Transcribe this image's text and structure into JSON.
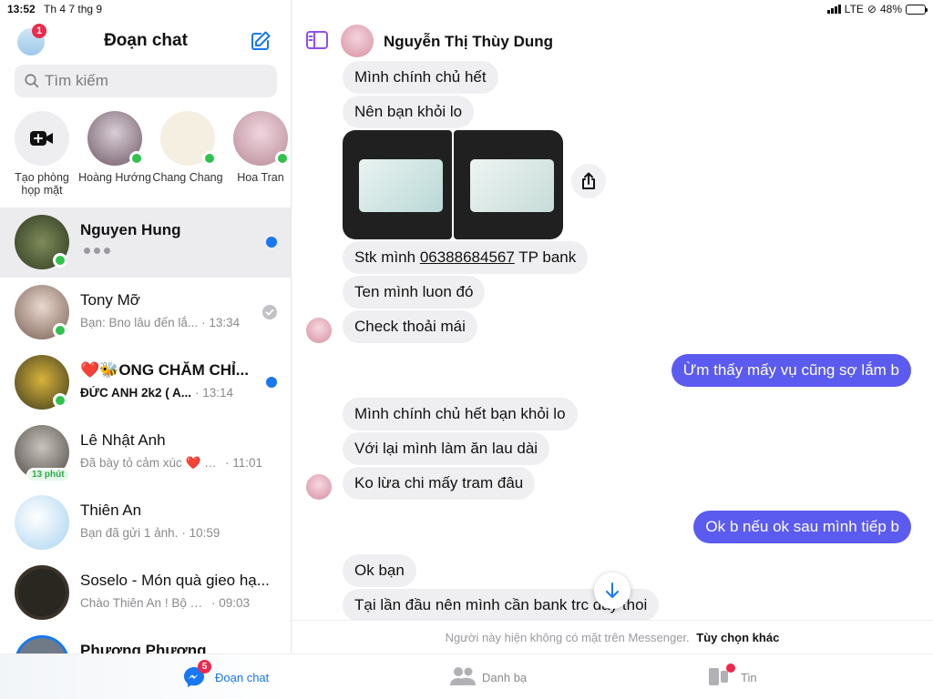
{
  "status_bar": {
    "time": "13:52",
    "date": "Th 4 7 thg 9",
    "network": "LTE",
    "battery": "48%",
    "battery_level": 0.48
  },
  "sidebar": {
    "title": "Đoạn chat",
    "profile_badge": "1",
    "search_placeholder": "Tìm kiếm",
    "stories": [
      {
        "label": "Tạo phòng họp mặt",
        "icon": "video-plus-icon"
      },
      {
        "label": "Hoàng Hướng",
        "online": true
      },
      {
        "label": "Chang Chang",
        "online": true
      },
      {
        "label": "Hoa Tran",
        "online": true
      }
    ],
    "chats": [
      {
        "name": "Nguyen Hung",
        "typing": true,
        "unread": true,
        "online": true
      },
      {
        "name": "Tony Mỡ",
        "preview": "Bạn: Bno lâu đến lắ...",
        "time": "· 13:34",
        "seen": true,
        "online": true
      },
      {
        "name": "❤️🐝ONG CHĂM CHỈ...",
        "preview": "ĐỨC ANH  2k2 ( A...",
        "time": "· 13:14",
        "unread": true,
        "online": true
      },
      {
        "name": "Lê Nhật Anh",
        "preview": "Đã bày tỏ cảm xúc ❤️ về...",
        "time": "· 11:01",
        "badge": "13 phút"
      },
      {
        "name": "Thiên An",
        "preview": "Bạn đã gửi 1 ảnh.",
        "time": "· 10:59"
      },
      {
        "name": "Soselo - Món quà gieo hạ...",
        "preview": "Chào Thiên An ! Bộ sưu...",
        "time": "· 09:03"
      },
      {
        "name": "Phương Phương",
        "preview": "",
        "time": ""
      }
    ]
  },
  "conversation": {
    "contact_name": "Nguyễn Thị Thùy Dung",
    "messages": [
      {
        "text": "Mình chính chủ hết",
        "dir": "in"
      },
      {
        "text": "Nên bạn khỏi lo",
        "dir": "in"
      },
      {
        "text_before": "Stk mình ",
        "account": "06388684567",
        "text_after": " TP bank",
        "dir": "in"
      },
      {
        "text": "Ten mình luon đó",
        "dir": "in"
      },
      {
        "text": "Check thoải mái",
        "dir": "in"
      },
      {
        "text": "Ừm thấy mấy vụ cũng sợ lắm b",
        "dir": "out"
      },
      {
        "text": "Mình chính chủ hết bạn khỏi lo",
        "dir": "in"
      },
      {
        "text": "Với lại mình làm ăn lau dài",
        "dir": "in"
      },
      {
        "text": "Ko lừa chi mấy tram đâu",
        "dir": "in"
      },
      {
        "text": "Ok b nếu ok sau mình tiếp b",
        "dir": "out"
      },
      {
        "text": "Ok bạn",
        "dir": "in"
      },
      {
        "text": "Tại lần đầu nên mình cần bank trc đây thoi",
        "dir": "in"
      }
    ],
    "footer_text": "Người này hiện không có mặt trên Messenger.",
    "footer_link": "Tùy chọn khác"
  },
  "tabbar": {
    "tabs": [
      {
        "label": "Đoạn chat",
        "badge": "5",
        "active": true,
        "icon": "chat-bubble-icon"
      },
      {
        "label": "Danh bạ",
        "icon": "people-icon"
      },
      {
        "label": "Tin",
        "icon": "stories-icon",
        "dot": true
      }
    ]
  },
  "colors": {
    "accent": "#1877f2",
    "outgoing_bubble": "#5b5bf0",
    "incoming_bubble": "#efeff1",
    "online": "#31c24d",
    "badge": "#f0284a",
    "sidebar_toggle": "#8e4ff0"
  }
}
